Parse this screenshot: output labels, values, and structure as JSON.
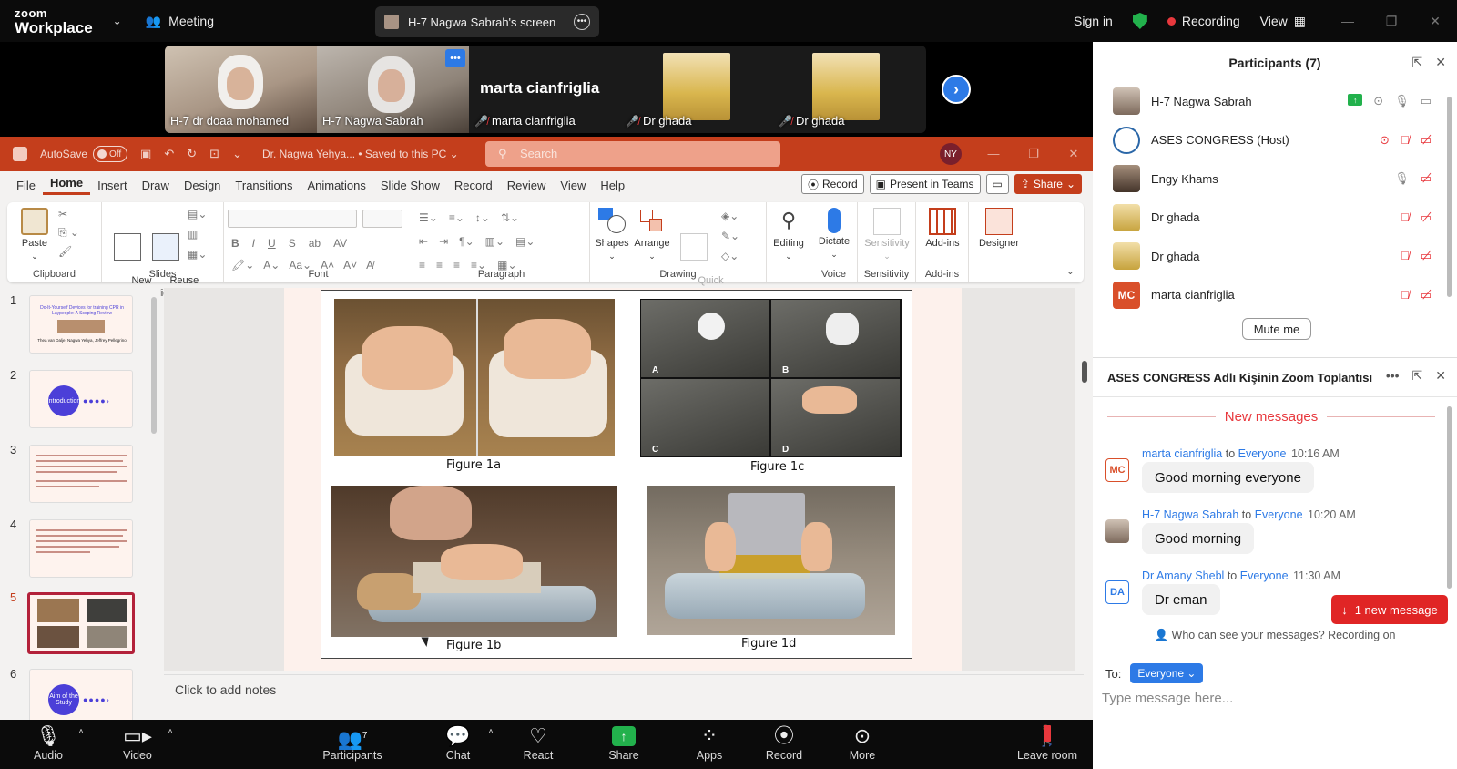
{
  "app": {
    "logo_line1": "zoom",
    "logo_line2": "Workplace",
    "meeting_label": "Meeting",
    "screen_share_label": "H-7 Nagwa Sabrah's screen",
    "sign_in": "Sign in",
    "recording": "Recording",
    "view": "View"
  },
  "video_strip": {
    "tiles": [
      {
        "name": "H-7 dr doaa mohamed"
      },
      {
        "name": "H-7 Nagwa Sabrah"
      },
      {
        "name": "marta cianfriglia",
        "big_name": "marta cianfriglia"
      },
      {
        "name": "Dr ghada"
      },
      {
        "name": "Dr ghada"
      }
    ]
  },
  "ppt": {
    "autosave": "AutoSave",
    "autosave_state": "Off",
    "doc_name": "Dr. Nagwa Yehya... • Saved to this PC ⌄",
    "search_placeholder": "Search",
    "user_initials": "NY",
    "menu": [
      "File",
      "Home",
      "Insert",
      "Draw",
      "Design",
      "Transitions",
      "Animations",
      "Slide Show",
      "Record",
      "Review",
      "View",
      "Help"
    ],
    "record_btn": "Record",
    "present_btn": "Present in Teams",
    "share_btn": "Share",
    "ribbon": {
      "paste": "Paste",
      "clipboard": "Clipboard",
      "new_slide": "New\nSlide",
      "reuse_slides": "Reuse\nSlides",
      "slides": "Slides",
      "font": "Font",
      "paragraph": "Paragraph",
      "shapes": "Shapes",
      "arrange": "Arrange",
      "quick_styles": "Quick\nStyles",
      "drawing": "Drawing",
      "editing": "Editing",
      "dictate": "Dictate",
      "voice": "Voice",
      "sensitivity_btn": "Sensitivity",
      "sensitivity": "Sensitivity",
      "addins_btn": "Add-ins",
      "addins": "Add-ins",
      "designer": "Designer"
    },
    "thumbnails": [
      {
        "num": "1",
        "title": "Do-It-Yourself Devices for training CPR in Laypeople: A Scoping Review",
        "authors": "Thea van Dalje, Nagwa Yehya, Jeffrey Pellegrino"
      },
      {
        "num": "2",
        "circle": "Introduction"
      },
      {
        "num": "3"
      },
      {
        "num": "4"
      },
      {
        "num": "5"
      },
      {
        "num": "6",
        "circle": "Aim of the Study"
      }
    ],
    "figures": {
      "f1a": "Figure 1a",
      "f1c": "Figure 1c",
      "f1b": "Figure 1b",
      "f1d": "Figure 1d",
      "quad_labels": [
        "A",
        "B",
        "C",
        "D"
      ]
    },
    "notes_placeholder": "Click to add notes"
  },
  "participants": {
    "header": "Participants (7)",
    "list": [
      {
        "name": "H-7 Nagwa Sabrah"
      },
      {
        "name": "ASES CONGRESS (Host)"
      },
      {
        "name": "Engy Khams"
      },
      {
        "name": "Dr ghada"
      },
      {
        "name": "Dr ghada"
      },
      {
        "name": "marta cianfriglia",
        "initials": "MC"
      }
    ],
    "mute_me": "Mute me"
  },
  "chat": {
    "header": "ASES CONGRESS Adlı Kişinin Zoom Toplantısı",
    "new_messages": "New messages",
    "messages": [
      {
        "initials": "MC",
        "sender": "marta cianfriglia",
        "to": "to",
        "recipient": "Everyone",
        "time": "10:16 AM",
        "text": "Good morning everyone",
        "color": "#d94f2a"
      },
      {
        "initials": "",
        "sender": "H-7 Nagwa Sabrah",
        "to": "to",
        "recipient": "Everyone",
        "time": "10:20 AM",
        "text": "Good morning",
        "color": "#8c7b6e"
      },
      {
        "initials": "DA",
        "sender": "Dr Amany Shebl",
        "to": "to",
        "recipient": "Everyone",
        "time": "11:30 AM",
        "text": "Dr eman",
        "color": "#2d7ae6"
      }
    ],
    "new_message_btn": "1 new message",
    "who_can_see": "Who can see your messages? Recording on",
    "to_label": "To:",
    "to_value": "Everyone",
    "input_placeholder": "Type message here..."
  },
  "toolbar": {
    "audio": "Audio",
    "video": "Video",
    "participants": "Participants",
    "participants_count": "7",
    "chat": "Chat",
    "react": "React",
    "share": "Share",
    "apps": "Apps",
    "record": "Record",
    "more": "More",
    "leave": "Leave room"
  },
  "colors": {
    "ppt_accent": "#c43e1c",
    "zoom_blue": "#2d7ae6",
    "record_red": "#e8383d",
    "share_green": "#22b14c"
  }
}
